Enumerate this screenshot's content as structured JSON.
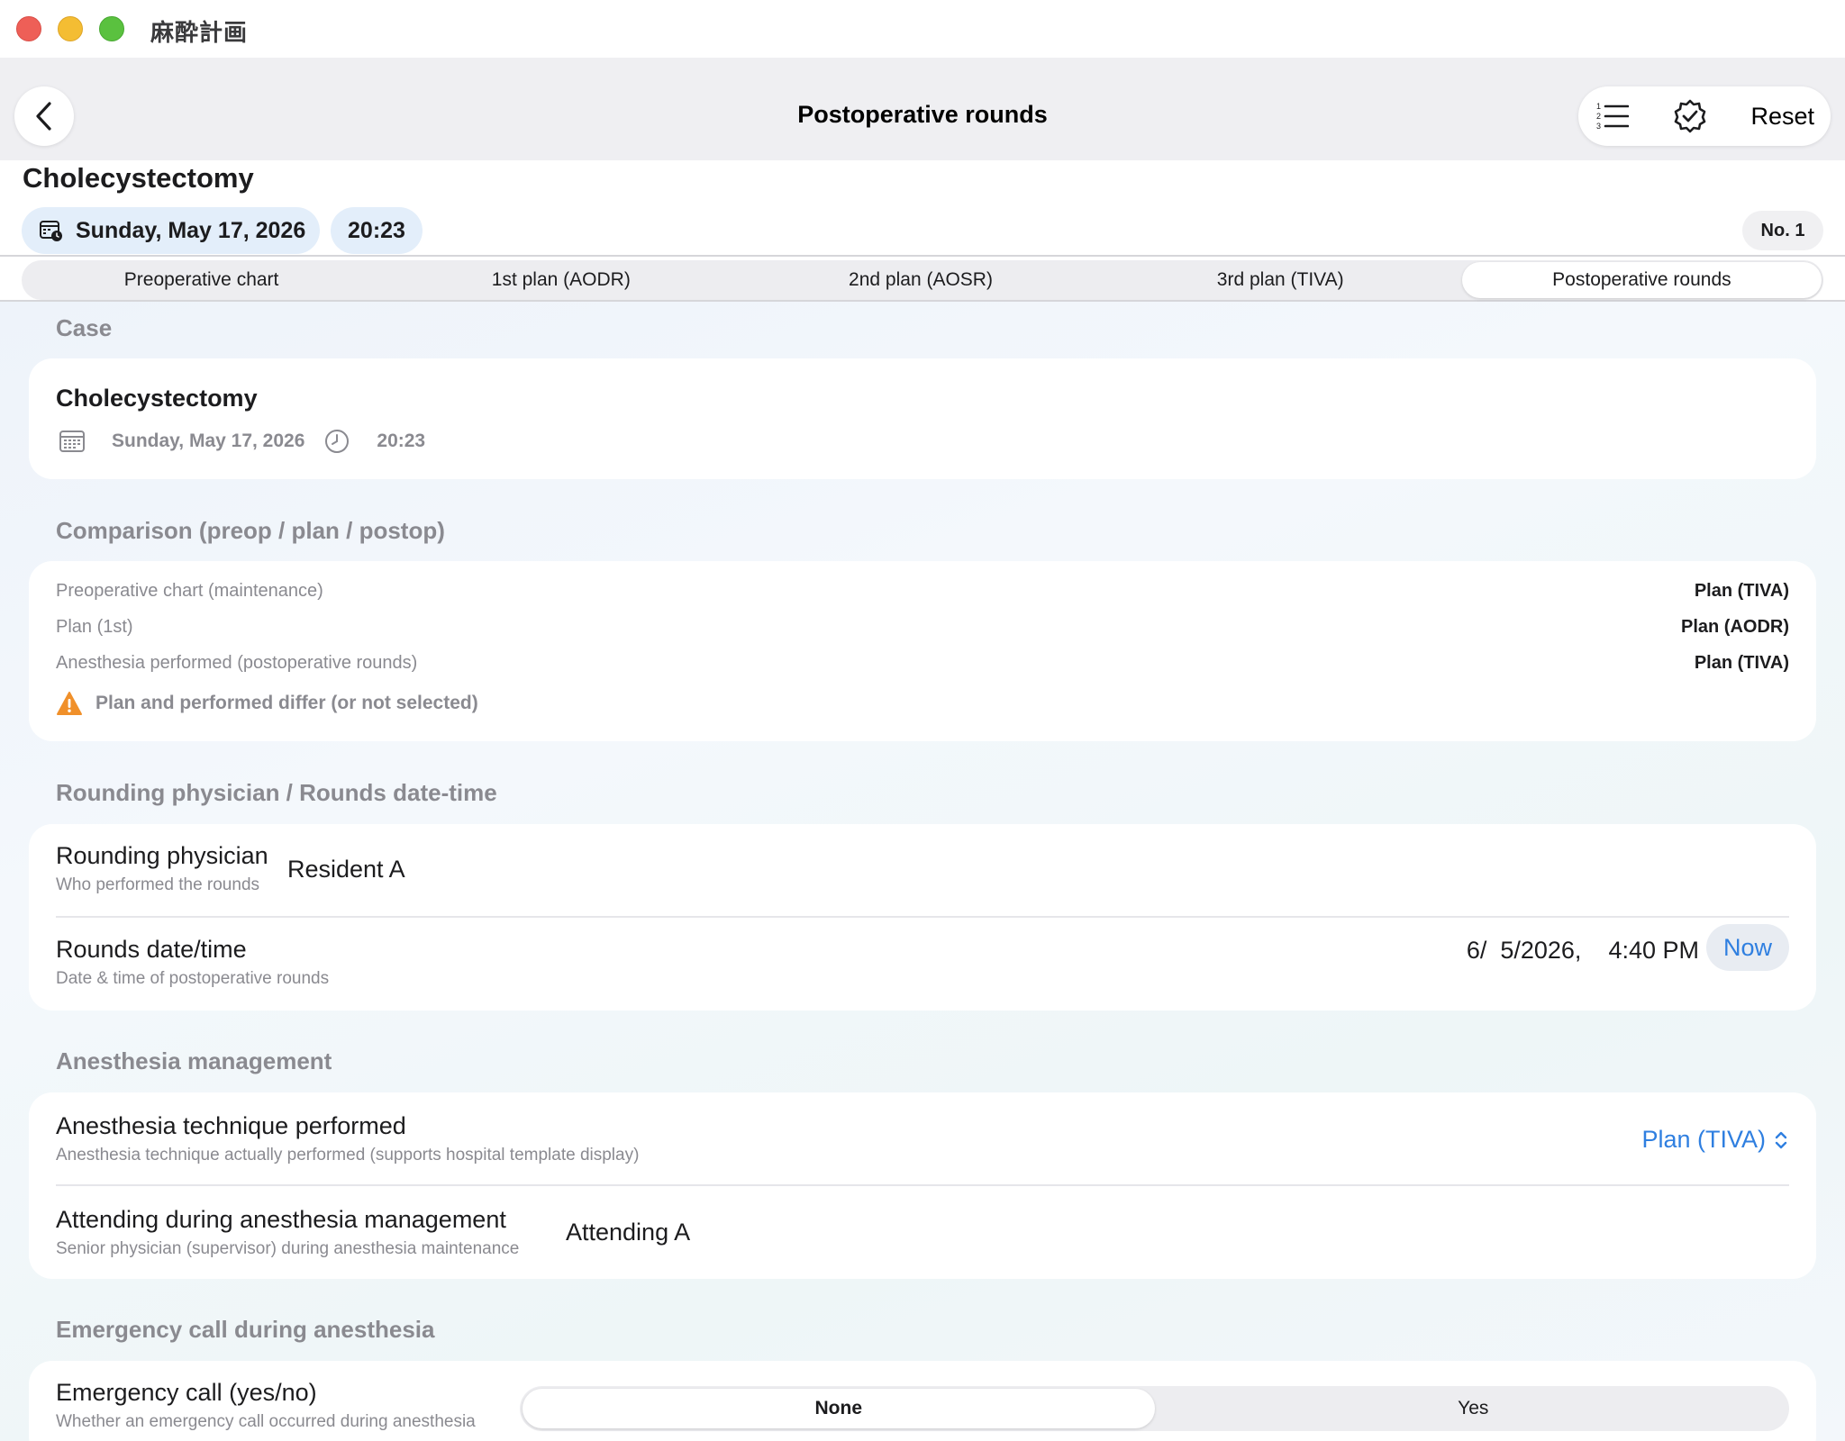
{
  "window": {
    "title": "麻酔計画"
  },
  "navbar": {
    "title": "Postoperative rounds",
    "reset_label": "Reset"
  },
  "header": {
    "case_title": "Cholecystectomy",
    "date": "Sunday, May 17, 2026",
    "time": "20:23",
    "number": "No. 1"
  },
  "tabs": [
    {
      "label": "Preoperative chart",
      "selected": false
    },
    {
      "label": "1st plan (AODR)",
      "selected": false
    },
    {
      "label": "2nd plan (AOSR)",
      "selected": false
    },
    {
      "label": "3rd plan (TIVA)",
      "selected": false
    },
    {
      "label": "Postoperative rounds",
      "selected": true
    }
  ],
  "case_section": {
    "label": "Case",
    "title": "Cholecystectomy",
    "date": "Sunday, May 17, 2026",
    "time": "20:23"
  },
  "comparison": {
    "label": "Comparison (preop / plan / postop)",
    "rows": [
      {
        "label": "Preoperative chart (maintenance)",
        "value": "Plan (TIVA)"
      },
      {
        "label": "Plan (1st)",
        "value": "Plan (AODR)"
      },
      {
        "label": "Anesthesia performed (postoperative rounds)",
        "value": "Plan (TIVA)"
      }
    ],
    "warning": "Plan and performed differ (or not selected)",
    "warning_color": "#f0902a"
  },
  "rounding": {
    "label": "Rounding physician / Rounds date-time",
    "physician_label": "Rounding physician",
    "physician_sub": "Who performed the rounds",
    "physician_value": "Resident A",
    "datetime_label": "Rounds date/time",
    "datetime_sub": "Date & time of postoperative rounds",
    "datetime_value": "6/  5/2026,    4:40 PM",
    "now_label": "Now"
  },
  "anesthesia": {
    "label": "Anesthesia management",
    "technique_label": "Anesthesia technique performed",
    "technique_sub": "Anesthesia technique actually performed (supports hospital template display)",
    "technique_value": "Plan (TIVA)",
    "attending_label": "Attending during anesthesia management",
    "attending_sub": "Senior physician (supervisor) during anesthesia maintenance",
    "attending_value": "Attending A"
  },
  "emergency": {
    "label": "Emergency call during anesthesia",
    "call_label": "Emergency call (yes/no)",
    "call_sub": "Whether an emergency call occurred during anesthesia",
    "options": [
      "None",
      "Yes"
    ],
    "selected": "None"
  },
  "colors": {
    "accent": "#2f7fe0",
    "chip_bg": "#e3eefa",
    "secondary_text": "#8a8a90"
  }
}
